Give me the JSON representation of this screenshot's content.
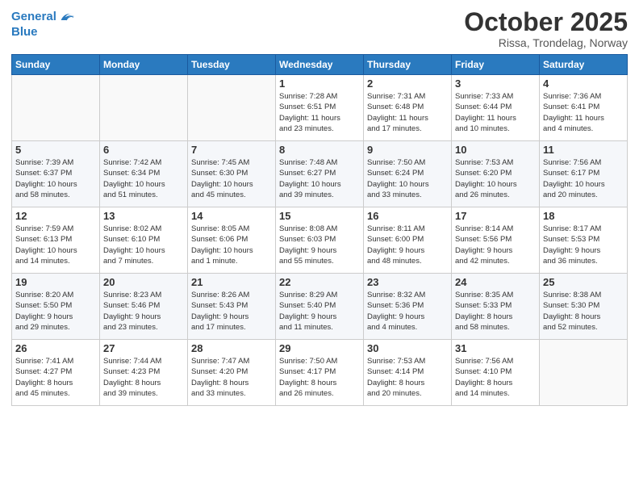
{
  "header": {
    "logo_line1": "General",
    "logo_line2": "Blue",
    "month_title": "October 2025",
    "location": "Rissa, Trondelag, Norway"
  },
  "days_of_week": [
    "Sunday",
    "Monday",
    "Tuesday",
    "Wednesday",
    "Thursday",
    "Friday",
    "Saturday"
  ],
  "weeks": [
    [
      {
        "day": "",
        "info": ""
      },
      {
        "day": "",
        "info": ""
      },
      {
        "day": "",
        "info": ""
      },
      {
        "day": "1",
        "info": "Sunrise: 7:28 AM\nSunset: 6:51 PM\nDaylight: 11 hours\nand 23 minutes."
      },
      {
        "day": "2",
        "info": "Sunrise: 7:31 AM\nSunset: 6:48 PM\nDaylight: 11 hours\nand 17 minutes."
      },
      {
        "day": "3",
        "info": "Sunrise: 7:33 AM\nSunset: 6:44 PM\nDaylight: 11 hours\nand 10 minutes."
      },
      {
        "day": "4",
        "info": "Sunrise: 7:36 AM\nSunset: 6:41 PM\nDaylight: 11 hours\nand 4 minutes."
      }
    ],
    [
      {
        "day": "5",
        "info": "Sunrise: 7:39 AM\nSunset: 6:37 PM\nDaylight: 10 hours\nand 58 minutes."
      },
      {
        "day": "6",
        "info": "Sunrise: 7:42 AM\nSunset: 6:34 PM\nDaylight: 10 hours\nand 51 minutes."
      },
      {
        "day": "7",
        "info": "Sunrise: 7:45 AM\nSunset: 6:30 PM\nDaylight: 10 hours\nand 45 minutes."
      },
      {
        "day": "8",
        "info": "Sunrise: 7:48 AM\nSunset: 6:27 PM\nDaylight: 10 hours\nand 39 minutes."
      },
      {
        "day": "9",
        "info": "Sunrise: 7:50 AM\nSunset: 6:24 PM\nDaylight: 10 hours\nand 33 minutes."
      },
      {
        "day": "10",
        "info": "Sunrise: 7:53 AM\nSunset: 6:20 PM\nDaylight: 10 hours\nand 26 minutes."
      },
      {
        "day": "11",
        "info": "Sunrise: 7:56 AM\nSunset: 6:17 PM\nDaylight: 10 hours\nand 20 minutes."
      }
    ],
    [
      {
        "day": "12",
        "info": "Sunrise: 7:59 AM\nSunset: 6:13 PM\nDaylight: 10 hours\nand 14 minutes."
      },
      {
        "day": "13",
        "info": "Sunrise: 8:02 AM\nSunset: 6:10 PM\nDaylight: 10 hours\nand 7 minutes."
      },
      {
        "day": "14",
        "info": "Sunrise: 8:05 AM\nSunset: 6:06 PM\nDaylight: 10 hours\nand 1 minute."
      },
      {
        "day": "15",
        "info": "Sunrise: 8:08 AM\nSunset: 6:03 PM\nDaylight: 9 hours\nand 55 minutes."
      },
      {
        "day": "16",
        "info": "Sunrise: 8:11 AM\nSunset: 6:00 PM\nDaylight: 9 hours\nand 48 minutes."
      },
      {
        "day": "17",
        "info": "Sunrise: 8:14 AM\nSunset: 5:56 PM\nDaylight: 9 hours\nand 42 minutes."
      },
      {
        "day": "18",
        "info": "Sunrise: 8:17 AM\nSunset: 5:53 PM\nDaylight: 9 hours\nand 36 minutes."
      }
    ],
    [
      {
        "day": "19",
        "info": "Sunrise: 8:20 AM\nSunset: 5:50 PM\nDaylight: 9 hours\nand 29 minutes."
      },
      {
        "day": "20",
        "info": "Sunrise: 8:23 AM\nSunset: 5:46 PM\nDaylight: 9 hours\nand 23 minutes."
      },
      {
        "day": "21",
        "info": "Sunrise: 8:26 AM\nSunset: 5:43 PM\nDaylight: 9 hours\nand 17 minutes."
      },
      {
        "day": "22",
        "info": "Sunrise: 8:29 AM\nSunset: 5:40 PM\nDaylight: 9 hours\nand 11 minutes."
      },
      {
        "day": "23",
        "info": "Sunrise: 8:32 AM\nSunset: 5:36 PM\nDaylight: 9 hours\nand 4 minutes."
      },
      {
        "day": "24",
        "info": "Sunrise: 8:35 AM\nSunset: 5:33 PM\nDaylight: 8 hours\nand 58 minutes."
      },
      {
        "day": "25",
        "info": "Sunrise: 8:38 AM\nSunset: 5:30 PM\nDaylight: 8 hours\nand 52 minutes."
      }
    ],
    [
      {
        "day": "26",
        "info": "Sunrise: 7:41 AM\nSunset: 4:27 PM\nDaylight: 8 hours\nand 45 minutes."
      },
      {
        "day": "27",
        "info": "Sunrise: 7:44 AM\nSunset: 4:23 PM\nDaylight: 8 hours\nand 39 minutes."
      },
      {
        "day": "28",
        "info": "Sunrise: 7:47 AM\nSunset: 4:20 PM\nDaylight: 8 hours\nand 33 minutes."
      },
      {
        "day": "29",
        "info": "Sunrise: 7:50 AM\nSunset: 4:17 PM\nDaylight: 8 hours\nand 26 minutes."
      },
      {
        "day": "30",
        "info": "Sunrise: 7:53 AM\nSunset: 4:14 PM\nDaylight: 8 hours\nand 20 minutes."
      },
      {
        "day": "31",
        "info": "Sunrise: 7:56 AM\nSunset: 4:10 PM\nDaylight: 8 hours\nand 14 minutes."
      },
      {
        "day": "",
        "info": ""
      }
    ]
  ]
}
